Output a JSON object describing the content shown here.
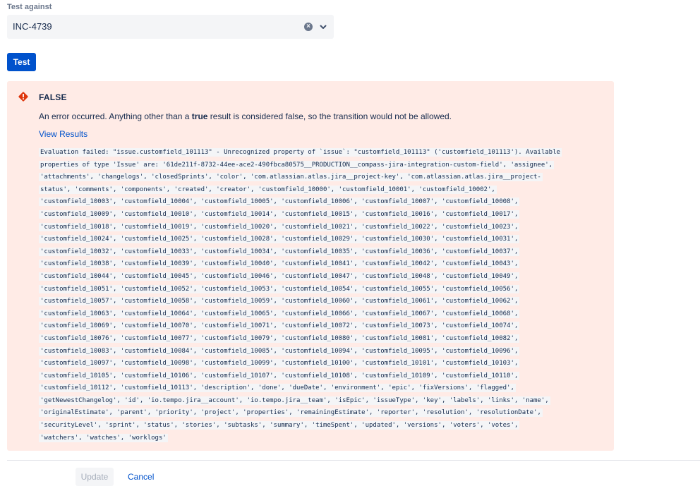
{
  "form": {
    "test_against_label": "Test against",
    "selected_issue": "INC-4739",
    "test_button": "Test"
  },
  "result": {
    "title": "FALSE",
    "message_prefix": "An error occurred. Anything other than a ",
    "message_bold": "true",
    "message_suffix": " result is considered false, so the transition would not be allowed.",
    "view_results": "View Results",
    "details_lines": [
      "Evaluation failed: \"issue.customfield_101113\" - Unrecognized property of `issue`: \"customfield_101113\" ('customfield_101113'). Available",
      "properties of type 'Issue' are: '61de211f-8732-44ee-ace2-490fbca80575__PRODUCTION__compass-jira-integration-custom-field', 'assignee',",
      "'attachments', 'changelogs', 'closedSprints', 'color', 'com.atlassian.atlas.jira__project-key', 'com.atlassian.atlas.jira__project-",
      "status', 'comments', 'components', 'created', 'creator', 'customfield_10000', 'customfield_10001', 'customfield_10002',",
      "'customfield_10003', 'customfield_10004', 'customfield_10005', 'customfield_10006', 'customfield_10007', 'customfield_10008',",
      "'customfield_10009', 'customfield_10010', 'customfield_10014', 'customfield_10015', 'customfield_10016', 'customfield_10017',",
      "'customfield_10018', 'customfield_10019', 'customfield_10020', 'customfield_10021', 'customfield_10022', 'customfield_10023',",
      "'customfield_10024', 'customfield_10025', 'customfield_10028', 'customfield_10029', 'customfield_10030', 'customfield_10031',",
      "'customfield_10032', 'customfield_10033', 'customfield_10034', 'customfield_10035', 'customfield_10036', 'customfield_10037',",
      "'customfield_10038', 'customfield_10039', 'customfield_10040', 'customfield_10041', 'customfield_10042', 'customfield_10043',",
      "'customfield_10044', 'customfield_10045', 'customfield_10046', 'customfield_10047', 'customfield_10048', 'customfield_10049',",
      "'customfield_10051', 'customfield_10052', 'customfield_10053', 'customfield_10054', 'customfield_10055', 'customfield_10056',",
      "'customfield_10057', 'customfield_10058', 'customfield_10059', 'customfield_10060', 'customfield_10061', 'customfield_10062',",
      "'customfield_10063', 'customfield_10064', 'customfield_10065', 'customfield_10066', 'customfield_10067', 'customfield_10068',",
      "'customfield_10069', 'customfield_10070', 'customfield_10071', 'customfield_10072', 'customfield_10073', 'customfield_10074',",
      "'customfield_10076', 'customfield_10077', 'customfield_10079', 'customfield_10080', 'customfield_10081', 'customfield_10082',",
      "'customfield_10083', 'customfield_10084', 'customfield_10085', 'customfield_10094', 'customfield_10095', 'customfield_10096',",
      "'customfield_10097', 'customfield_10098', 'customfield_10099', 'customfield_10100', 'customfield_10101', 'customfield_10103',",
      "'customfield_10105', 'customfield_10106', 'customfield_10107', 'customfield_10108', 'customfield_10109', 'customfield_10110',",
      "'customfield_10112', 'customfield_10113', 'description', 'done', 'dueDate', 'environment', 'epic', 'fixVersions', 'flagged',",
      "'getNewestChangelog', 'id', 'io.tempo.jira__account', 'io.tempo.jira__team', 'isEpic', 'issueType', 'key', 'labels', 'links', 'name',",
      "'originalEstimate', 'parent', 'priority', 'project', 'properties', 'remainingEstimate', 'reporter', 'resolution', 'resolutionDate',",
      "'securityLevel', 'sprint', 'status', 'stories', 'subtasks', 'summary', 'timeSpent', 'updated', 'versions', 'voters', 'votes',",
      "'watchers', 'watches', 'worklogs'"
    ]
  },
  "footer": {
    "update_button": "Update",
    "cancel_link": "Cancel"
  },
  "colors": {
    "primary": "#0052cc",
    "error_background": "#ffebe6",
    "error_icon": "#de350b"
  },
  "icons": {
    "clear": "clear-icon",
    "chevron": "chevron-down-icon",
    "error": "error-icon"
  }
}
